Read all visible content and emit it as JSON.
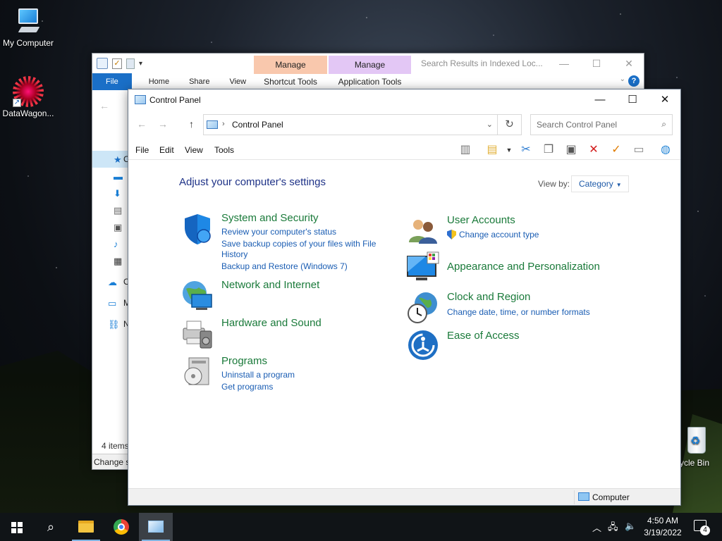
{
  "desktop": {
    "icons": [
      {
        "label": "My Computer"
      },
      {
        "label": "DataWagon..."
      },
      {
        "label": "ycle Bin"
      }
    ]
  },
  "explorer_back": {
    "qat": {
      "dropdown": "▾"
    },
    "context_tabs": [
      {
        "group": "Manage",
        "tab": "Shortcut Tools",
        "color": "#f9c8ad"
      },
      {
        "group": "Manage",
        "tab": "Application Tools",
        "color": "#e3c7f5"
      }
    ],
    "title": "Search Results in Indexed Loc...",
    "ribbon_tabs": [
      "File",
      "Home",
      "Share",
      "View"
    ],
    "help": "?",
    "sidebar_first_letter": "C",
    "sidebar_letters": [
      "O",
      "M",
      "N"
    ],
    "item_count": "4 items",
    "status": "Change s"
  },
  "control_panel": {
    "title": "Control Panel",
    "address": "Control Panel",
    "search_placeholder": "Search Control Panel",
    "menu": [
      "File",
      "Edit",
      "View",
      "Tools"
    ],
    "heading": "Adjust your computer's settings",
    "view_by_label": "View by:",
    "view_by_value": "Category",
    "left_categories": [
      {
        "title": "System and Security",
        "links": [
          "Review your computer's status",
          "Save backup copies of your files with File",
          "History",
          "Backup and Restore (Windows 7)"
        ]
      },
      {
        "title": "Network and Internet",
        "links": []
      },
      {
        "title": "Hardware and Sound",
        "links": []
      },
      {
        "title": "Programs",
        "links": [
          "Uninstall a program",
          "Get programs"
        ]
      }
    ],
    "right_categories": [
      {
        "title": "User Accounts",
        "links": [
          "Change account type"
        ]
      },
      {
        "title": "Appearance and Personalization",
        "links": []
      },
      {
        "title": "Clock and Region",
        "links": [
          "Change date, time, or number formats"
        ]
      },
      {
        "title": "Ease of Access",
        "links": []
      }
    ],
    "status_location": "Computer",
    "colors": {
      "heading": "#1e3287",
      "category_title": "#1a7a3a",
      "link": "#1a5db3"
    }
  },
  "taskbar": {
    "time": "4:50 AM",
    "date": "3/19/2022",
    "notification_count": "4"
  }
}
